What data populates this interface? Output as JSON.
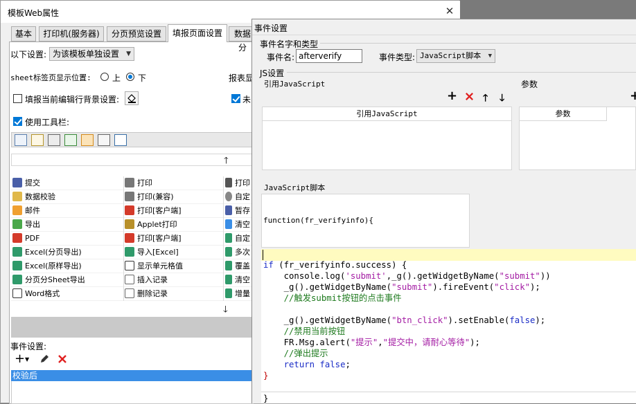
{
  "dialog1": {
    "title": "模板Web属性",
    "close": "✕",
    "tabs": [
      "基本",
      "打印机(服务器)",
      "分页预览设置",
      "填报页面设置",
      "数据分"
    ],
    "settings_label": "以下设置:",
    "settings_value": "为该模板单独设置",
    "sheet_tab_label": "sheet标签页显示位置:",
    "radio_top": "上",
    "radio_bottom": "下",
    "report_display_label": "报表显",
    "fill_bg_label": "填报当前编辑行背景设置:",
    "unfilled_label": "未",
    "use_toolbar_label": "使用工具栏:",
    "grid_col1": [
      "提交",
      "数据校验",
      "邮件",
      "导出",
      "PDF",
      "Excel(分页导出)",
      "Excel(原样导出)",
      "分页分Sheet导出",
      "Word格式"
    ],
    "grid_col2": [
      "打印",
      "打印(兼容)",
      "打印[客户端]",
      "Applet打印",
      "打印[客户端]",
      "导入[Excel]",
      "显示单元格值",
      "插入记录",
      "删除记录"
    ],
    "grid_col3": [
      "打印",
      "自定",
      "暂存",
      "清空",
      "自定",
      "多次",
      "覆盖",
      "清空",
      "增量"
    ],
    "event_settings_label": "事件设置:",
    "event_selected": "校验后"
  },
  "dialog2": {
    "title": "事件设置",
    "group_name_type": "事件名字和类型",
    "event_name_label": "事件名:",
    "event_name_value": "afterverify",
    "event_type_label": "事件类型:",
    "event_type_value": "JavaScript脚本",
    "group_js": "JS设置",
    "ref_js_label": "引用JavaScript",
    "params_label": "参数",
    "ref_js_header": "引用JavaScript",
    "params_header": "参数",
    "js_script_label": "JavaScript脚本",
    "function_sig": "function(fr_verifyinfo){",
    "code": {
      "l1_kw": "if",
      "l1_rest": " (fr_verifyinfo.success) {",
      "l2_a": "    console.log(",
      "l2_s": "'submit'",
      "l2_b": ",_g().getWidgetByName(",
      "l2_s2": "\"submit\"",
      "l2_c": "))",
      "l3_a": "    _g().getWidgetByName(",
      "l3_s": "\"submit\"",
      "l3_b": ").fireEvent(",
      "l3_s2": "\"click\"",
      "l3_c": ");",
      "l4": "    //触发submit按钮的点击事件",
      "l6_a": "    _g().getWidgetByName(",
      "l6_s": "\"btn_click\"",
      "l6_b": ").setEnable(",
      "l6_kw": "false",
      "l6_c": ");",
      "l7": "    //禁用当前按钮",
      "l8_a": "    FR.Msg.alert(",
      "l8_s": "\"提示\"",
      "l8_b": ",",
      "l8_s2": "\"提交中，请耐心等待\"",
      "l8_c": ");",
      "l9": "    //弹出提示",
      "l10_kw": "    return",
      "l10_kw2": " false",
      "l10_c": ";",
      "l11": "}",
      "l12": "}"
    }
  }
}
